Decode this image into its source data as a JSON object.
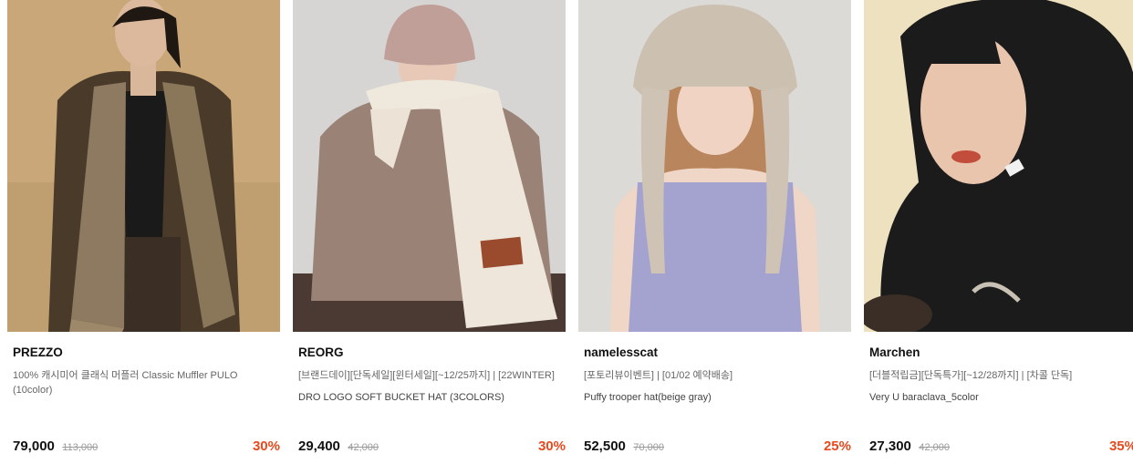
{
  "products": [
    {
      "brand": "PREZZO",
      "desc": "100% 캐시미어 클래식 머플러 Classic Muffler PULO (10color)",
      "sub": "",
      "price": "79,000",
      "original_price": "113,000",
      "discount": "30%"
    },
    {
      "brand": "REORG",
      "desc": "[브랜드데이][단독세일][윈터세일][~12/25까지] | [22WINTER]",
      "sub": "DRO LOGO SOFT BUCKET HAT (3COLORS)",
      "price": "29,400",
      "original_price": "42,000",
      "discount": "30%"
    },
    {
      "brand": "namelesscat",
      "desc": "[포토리뷰이벤트] | [01/02 예약배송]",
      "sub": "Puffy trooper hat(beige gray)",
      "price": "52,500",
      "original_price": "70,000",
      "discount": "25%"
    },
    {
      "brand": "Marchen",
      "desc": "[더블적립금][단독특가][~12/28까지] | [차콜 단독]",
      "sub": "Very U baraclava_5color",
      "price": "27,300",
      "original_price": "42,000",
      "discount": "35%"
    }
  ],
  "colors": {
    "discount": "#e8491d",
    "strike": "#9a9a9a"
  }
}
